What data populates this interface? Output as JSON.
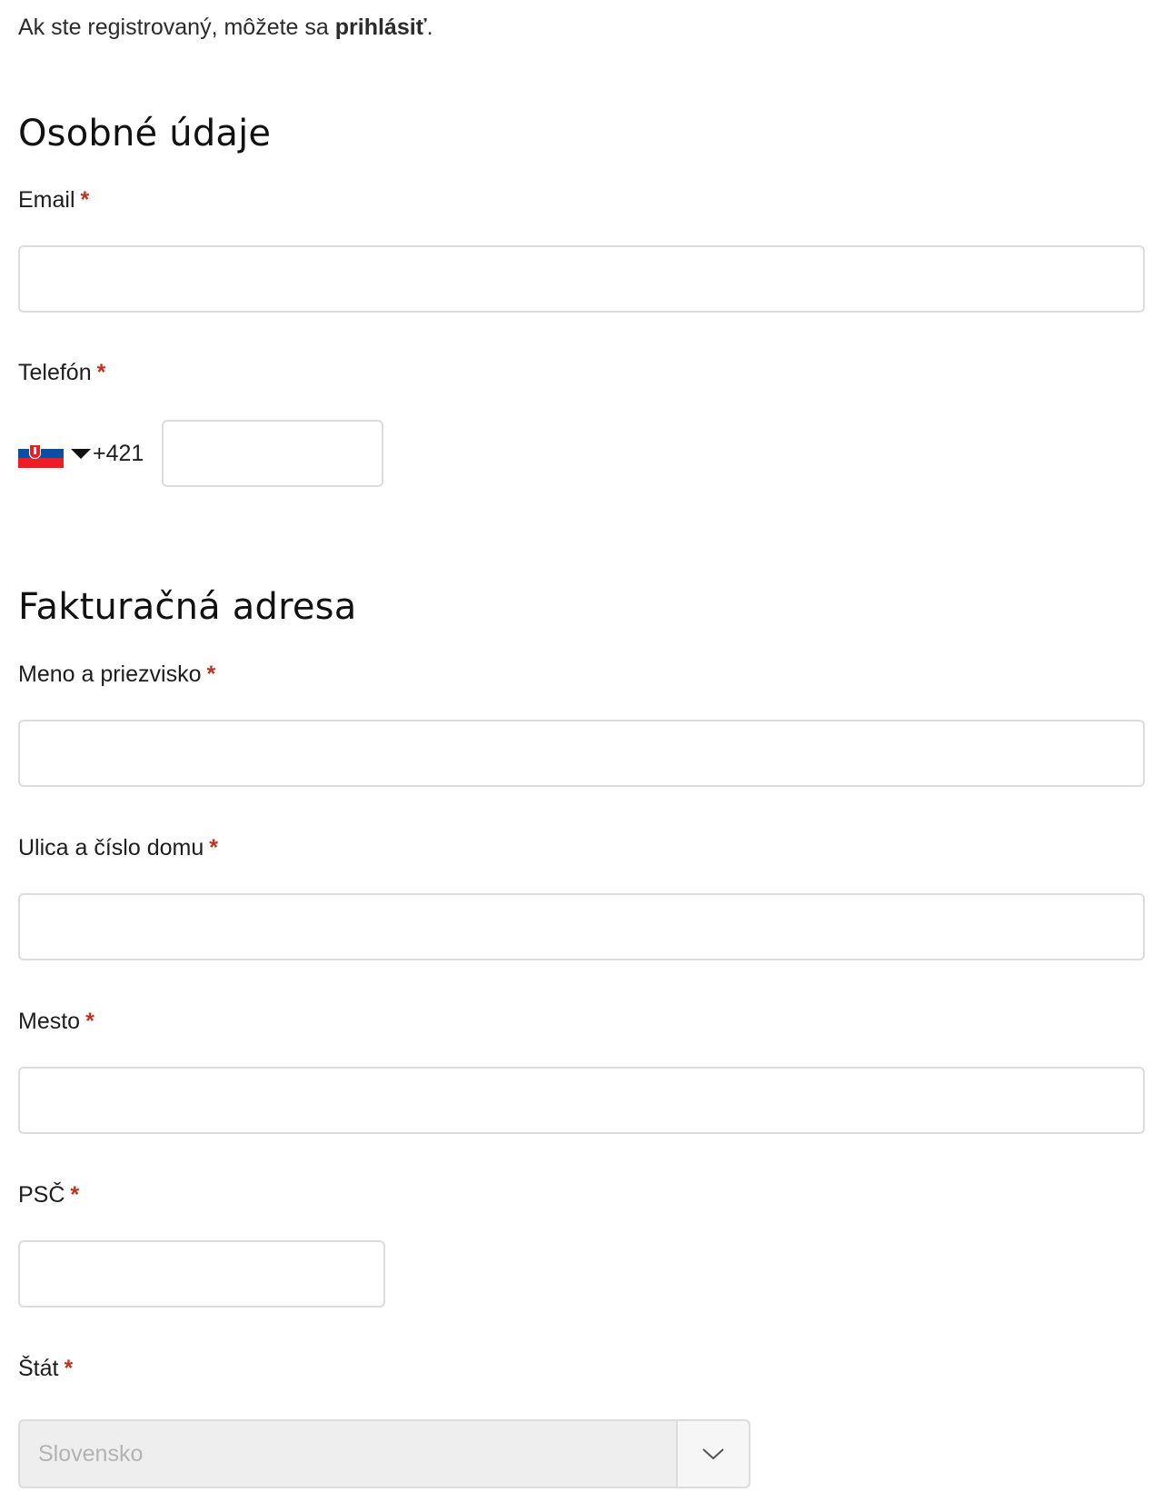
{
  "login": {
    "text": "Ak ste registrovaný, môžete sa",
    "link": "prihlásiť",
    "end": "."
  },
  "personal": {
    "heading": "Osobné údaje",
    "email_label": "Email",
    "phone_label": "Telefón",
    "phone_dial_code": "+421",
    "phone_country_flag": "slovakia-flag-icon"
  },
  "billing": {
    "heading": "Fakturačná adresa",
    "name_label": "Meno a priezvisko",
    "street_label": "Ulica a číslo domu",
    "city_label": "Mesto",
    "zip_label": "PSČ",
    "country_label": "Štát",
    "country_value": "Slovensko"
  },
  "required_marker": "*",
  "colors": {
    "required": "#c0321e",
    "border": "#dcdcdc",
    "disabled_bg": "#eeeeee"
  }
}
